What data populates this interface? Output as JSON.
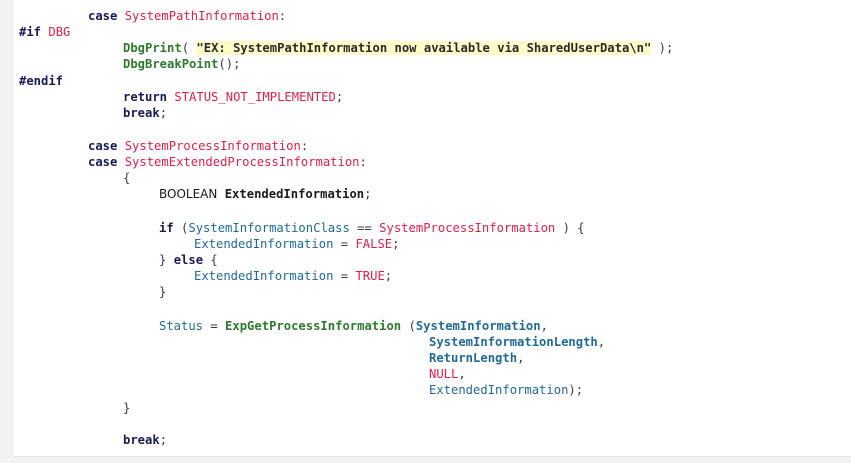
{
  "code": {
    "l1": {
      "kw": "case",
      "id": "SystemPathInformation",
      "p": ":"
    },
    "l2": {
      "pp": "#if",
      "id": "DBG"
    },
    "l3": {
      "fn": "DbgPrint",
      "p1": "( ",
      "str": "\"EX: SystemPathInformation now available via SharedUserData\\n\"",
      "p2": " );"
    },
    "l4": {
      "fn": "DbgBreakPoint",
      "p": "();"
    },
    "l5": {
      "pp": "#endif"
    },
    "l6": {
      "kw": "return",
      "id": "STATUS_NOT_IMPLEMENTED",
      "p": ";"
    },
    "l7": {
      "kw": "break",
      "p": ";"
    },
    "l8": {
      "kw": "case",
      "id": "SystemProcessInformation",
      "p": ":"
    },
    "l9": {
      "kw": "case",
      "id": "SystemExtendedProcessInformation",
      "p": ":"
    },
    "l10": {
      "p": "{"
    },
    "l11": {
      "ty": "BOOLEAN",
      "var": "ExtendedInformation",
      "p": ";"
    },
    "l12": {
      "kw": "if",
      "p1": " (",
      "v1": "SystemInformationClass",
      "op": " == ",
      "id": "SystemProcessInformation",
      "p2": " ) {"
    },
    "l13": {
      "var": "ExtendedInformation",
      "op": " = ",
      "id": "FALSE",
      "p": ";"
    },
    "l14": {
      "p1": "} ",
      "kw": "else",
      "p2": " {"
    },
    "l15": {
      "var": "ExtendedInformation",
      "op": " = ",
      "id": "TRUE",
      "p": ";"
    },
    "l16": {
      "p": "}"
    },
    "l17": {
      "var": "Status",
      "op": " = ",
      "fn": "ExpGetProcessInformation",
      "p1": " (",
      "a": "SystemInformation",
      "p2": ","
    },
    "l18": {
      "a": "SystemInformationLength",
      "p": ","
    },
    "l19": {
      "a": "ReturnLength",
      "p": ","
    },
    "l20": {
      "id": "NULL",
      "p": ","
    },
    "l21": {
      "var": "ExtendedInformation",
      "p": ");"
    },
    "l22": {
      "p": "}"
    },
    "l23": {
      "kw": "break",
      "p": ";"
    }
  }
}
